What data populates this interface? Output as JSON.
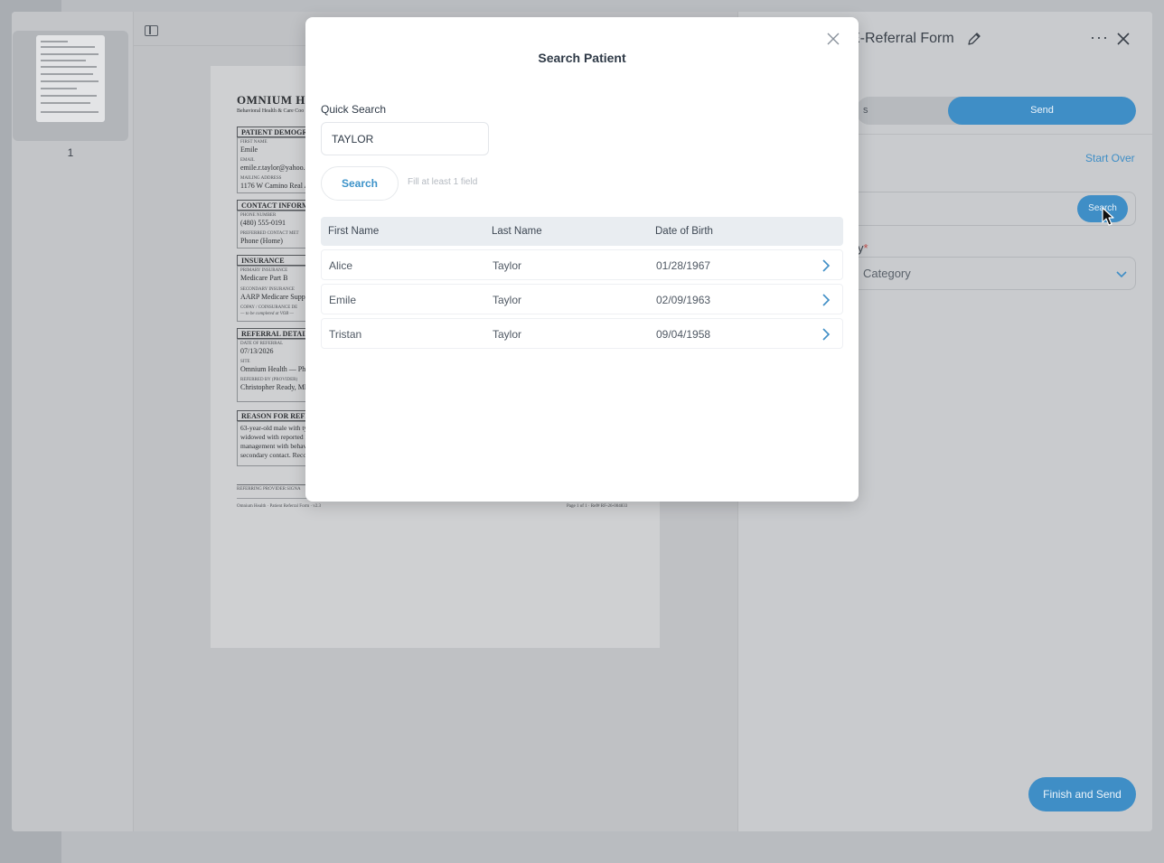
{
  "document": {
    "org_name": "OMNIUM HE",
    "org_subtitle": "Behavioral Health & Care Coo",
    "sections": {
      "demographics": "PATIENT DEMOGRA",
      "contact": "CONTACT INFORM",
      "insurance": "INSURANCE",
      "referral": "REFERRAL DETAIL",
      "reason": "REASON FOR REFE"
    },
    "fields": {
      "first_name_label": "FIRST NAME",
      "first_name": "Emile",
      "email_label": "EMAIL",
      "email": "emile.r.taylor@yahoo.co",
      "address_label": "MAILING ADDRESS",
      "address": "1176 W Camino Real Av",
      "phone_label": "PHONE NUMBER",
      "phone": "(480) 555-0191",
      "pref_contact_label": "PREFERRED CONTACT MET",
      "pref_contact": "Phone (Home)",
      "primary_ins_label": "PRIMARY INSURANCE",
      "primary_ins": "Medicare Part B",
      "secondary_ins_label": "SECONDARY INSURANCE",
      "secondary_ins": "AARP Medicare Supplen",
      "copay_label": "COPAY / COINSURANCE DE",
      "copay": "— to be completed at VOB —",
      "referral_date_label": "DATE OF REFERRAL",
      "referral_date": "07/13/2026",
      "site_label": "SITE",
      "site": "Omnium Health — Phoe",
      "referred_by_label": "REFERRED BY (PROVIDER)",
      "referred_by": "Christopher Ready, MD"
    },
    "reason_lines": [
      "63-year-old male with ty",
      "widowed with reported l",
      "management with behav",
      "secondary contact. Reco"
    ],
    "signature_label": "REFERRING PROVIDER SIGNA",
    "footer_left": "Omnium Health · Patient Referral Form · v2.3",
    "footer_right": "Page 1 of 1 · Ref# RF-26-004833"
  },
  "thumbnail": {
    "page_number": "1"
  },
  "right_panel": {
    "title": "E-Referral Form",
    "segment_left": "s",
    "segment_send": "Send",
    "start_over": "Start Over",
    "search_button": "Search",
    "category_label": "y",
    "category_required": "*",
    "category_placeholder": "Category",
    "finish_button": "Finish and Send"
  },
  "modal": {
    "title": "Search Patient",
    "quick_search_label": "Quick Search",
    "quick_search_value": "TAYLOR",
    "search_button": "Search",
    "hint": "Fill at least 1 field",
    "columns": [
      "First Name",
      "Last Name",
      "Date of Birth"
    ],
    "rows": [
      {
        "first": "Alice",
        "last": "Taylor",
        "dob": "01/28/1967"
      },
      {
        "first": "Emile",
        "last": "Taylor",
        "dob": "02/09/1963"
      },
      {
        "first": "Tristan",
        "last": "Taylor",
        "dob": "09/04/1958"
      }
    ]
  },
  "colors": {
    "accent": "#3f8ec6",
    "overlay": "#9fa3a8"
  }
}
